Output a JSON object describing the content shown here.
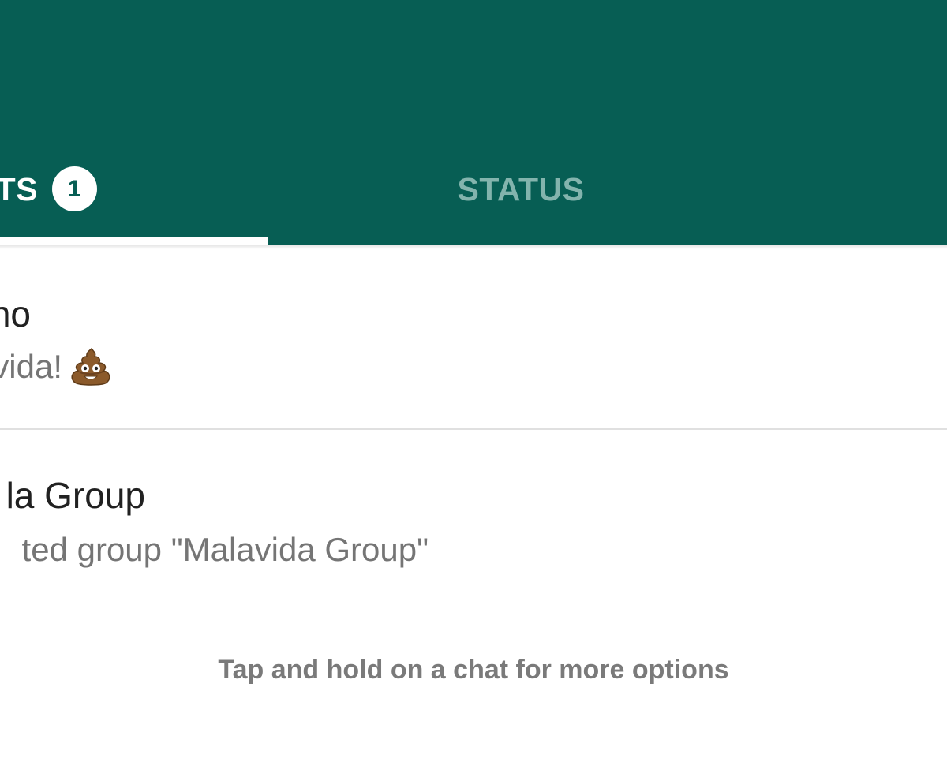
{
  "tabs": {
    "chats": {
      "label": "CHATS",
      "visible_label": "TS",
      "badge": "1"
    },
    "status": {
      "label": "STATUS"
    }
  },
  "chats": [
    {
      "name_visible": "no",
      "message_visible": "vida!",
      "emoji": "pile-of-poo-icon"
    },
    {
      "name_visible": "la Group",
      "message_visible": "ted group \"Malavida Group\""
    }
  ],
  "hint": "Tap and hold on a chat for more options",
  "colors": {
    "header": "#075e54",
    "inactive_tab": "#83b4ad",
    "name_text": "#212121",
    "message_text": "#757575",
    "hint_text": "#7a7a7a"
  }
}
